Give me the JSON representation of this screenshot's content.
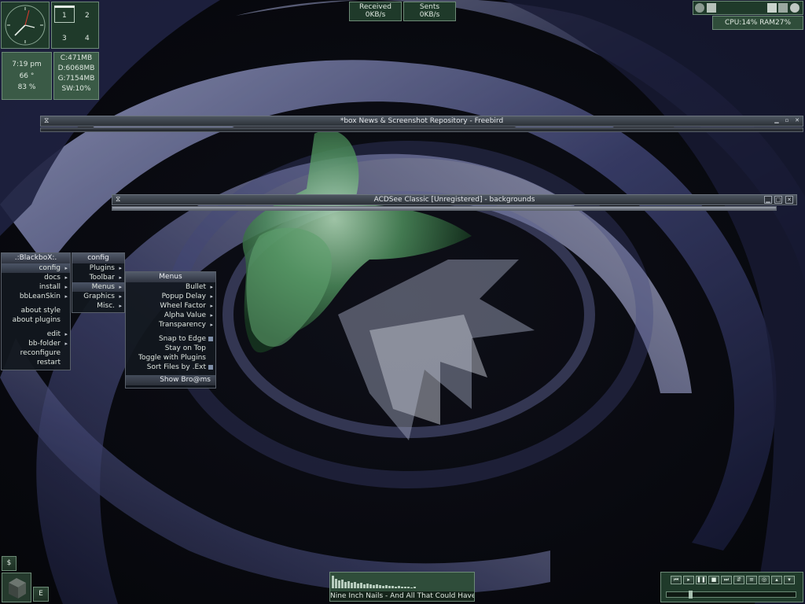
{
  "clock": {
    "time": "7:19 pm",
    "temp": "66 °",
    "battery": "83 %"
  },
  "workspaces": [
    "1",
    "2",
    "3",
    "4"
  ],
  "drives": [
    "C:471MB",
    "D:6068MB",
    "G:7154MB",
    "SW:10%"
  ],
  "network": {
    "received_label": "Received",
    "received_value": "0KB/s",
    "sent_label": "Sents",
    "sent_value": "0KB/s"
  },
  "system": {
    "cpu_ram": "CPU:14% RAM27%"
  },
  "windows": [
    {
      "title": "*box News & Screenshot Repository - Freebird"
    },
    {
      "title": "ACDSee Classic [Unregistered] - backgrounds"
    }
  ],
  "menu_root": {
    "title": ".:BlackboX:.",
    "items": [
      "config",
      "docs",
      "install",
      "bbLeanSkin",
      "about style",
      "about plugins",
      "edit",
      "bb-folder",
      "reconfigure",
      "restart"
    ]
  },
  "menu_config": {
    "title": "config",
    "items": [
      "Plugins",
      "Toolbar",
      "Menus",
      "Graphics",
      "Misc."
    ]
  },
  "menu_menus": {
    "title": "Menus",
    "items": [
      "Bullet",
      "Popup Delay",
      "Wheel Factor",
      "Alpha Value",
      "Transparency",
      "Snap to Edge",
      "Stay on Top",
      "Toggle with Plugins",
      "Sort Files by .Ext"
    ],
    "footer": "Show Bro@ms"
  },
  "taskbar": {
    "dollar": "$",
    "e_button": "E"
  },
  "player": {
    "now_playing": "Nine Inch Nails - And All That Could Have Be",
    "buttons": [
      "previous-icon",
      "rewind-icon",
      "pause-icon",
      "play-icon",
      "fast-forward-icon",
      "stop-icon",
      "shuffle-icon",
      "playlist-icon",
      "repeat-icon",
      "volume-up-icon",
      "volume-down-icon"
    ]
  },
  "colors": {
    "panel_green": "#2c4535",
    "menu_bg": "#12181e",
    "accent_blue": "#7f8fa8"
  }
}
